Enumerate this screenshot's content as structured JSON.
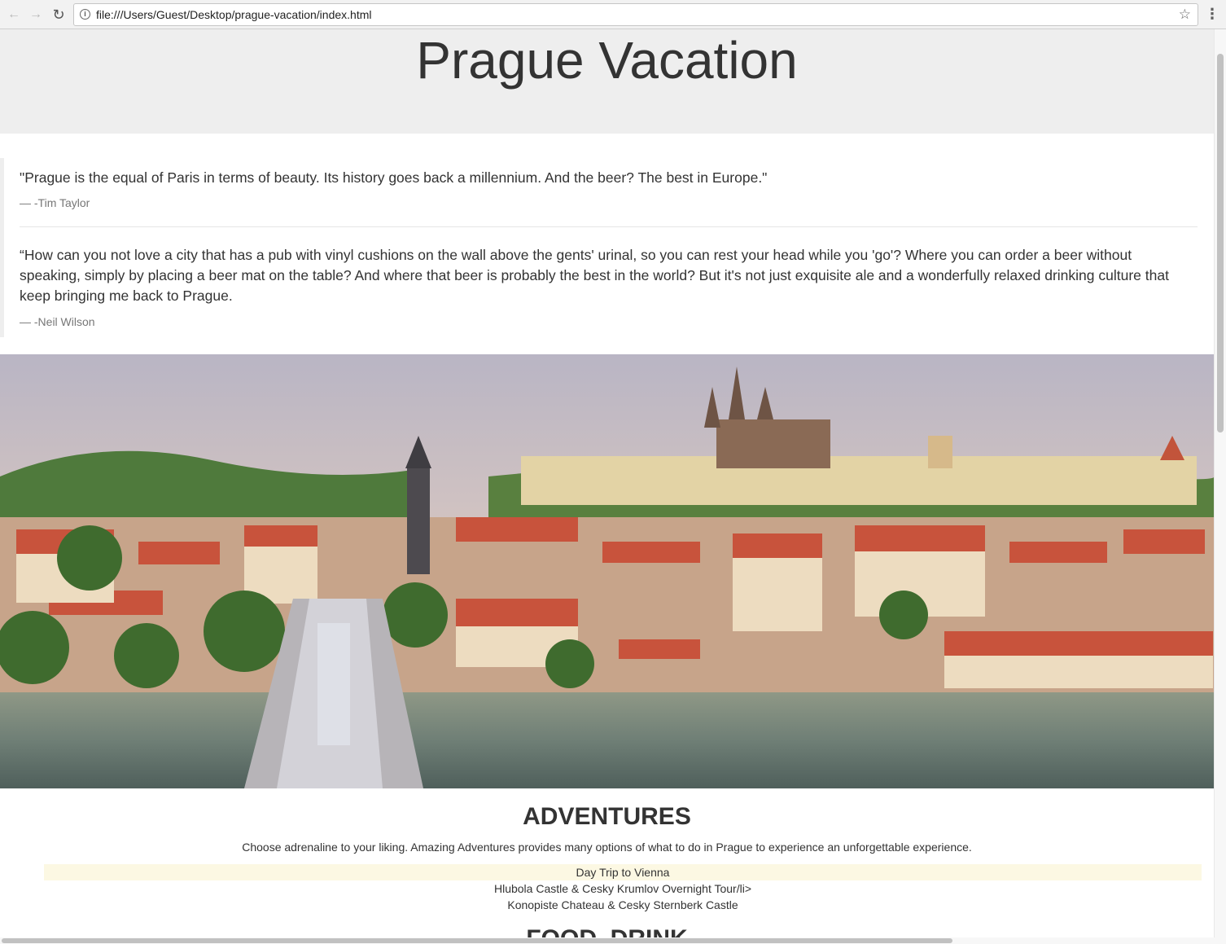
{
  "browser": {
    "url": "file:///Users/Guest/Desktop/prague-vacation/index.html",
    "back_icon": "←",
    "forward_icon": "→",
    "reload_icon": "↻",
    "info_icon": "i",
    "star_icon": "☆",
    "menu_icon": "⋮"
  },
  "page": {
    "title": "Prague Vacation",
    "quotes": [
      {
        "text": "\"Prague is the equal of Paris in terms of beauty. Its history goes back a millennium. And the beer? The best in Europe.\"",
        "author": "— -Tim Taylor"
      },
      {
        "text": "“How can you not love a city that has a pub with vinyl cushions on the wall above the gents' urinal, so you can rest your head while you 'go'? Where you can order a beer without speaking, simply by placing a beer mat on the table? And where that beer is probably the best in the world? But it's not just exquisite ale and a wonderfully relaxed drinking culture that keep bringing me back to Prague.",
        "author": "— -Neil Wilson"
      }
    ],
    "adventures": {
      "heading": "ADVENTURES",
      "description": "Choose adrenaline to your liking. Amazing Adventures provides many options of what to do in Prague to experience an unforgettable experience.",
      "tours": [
        "Day Trip to Vienna",
        "Hlubola Castle & Cesky Krumlov Overnight Tour/li>",
        "Konopiste Chateau & Cesky Sternberk Castle"
      ]
    },
    "next_heading": "FOOD, DRINK"
  },
  "colors": {
    "jumbotron": "#eeeeee",
    "highlight_row": "#fcf8e3",
    "text": "#333333",
    "muted": "#777777"
  }
}
